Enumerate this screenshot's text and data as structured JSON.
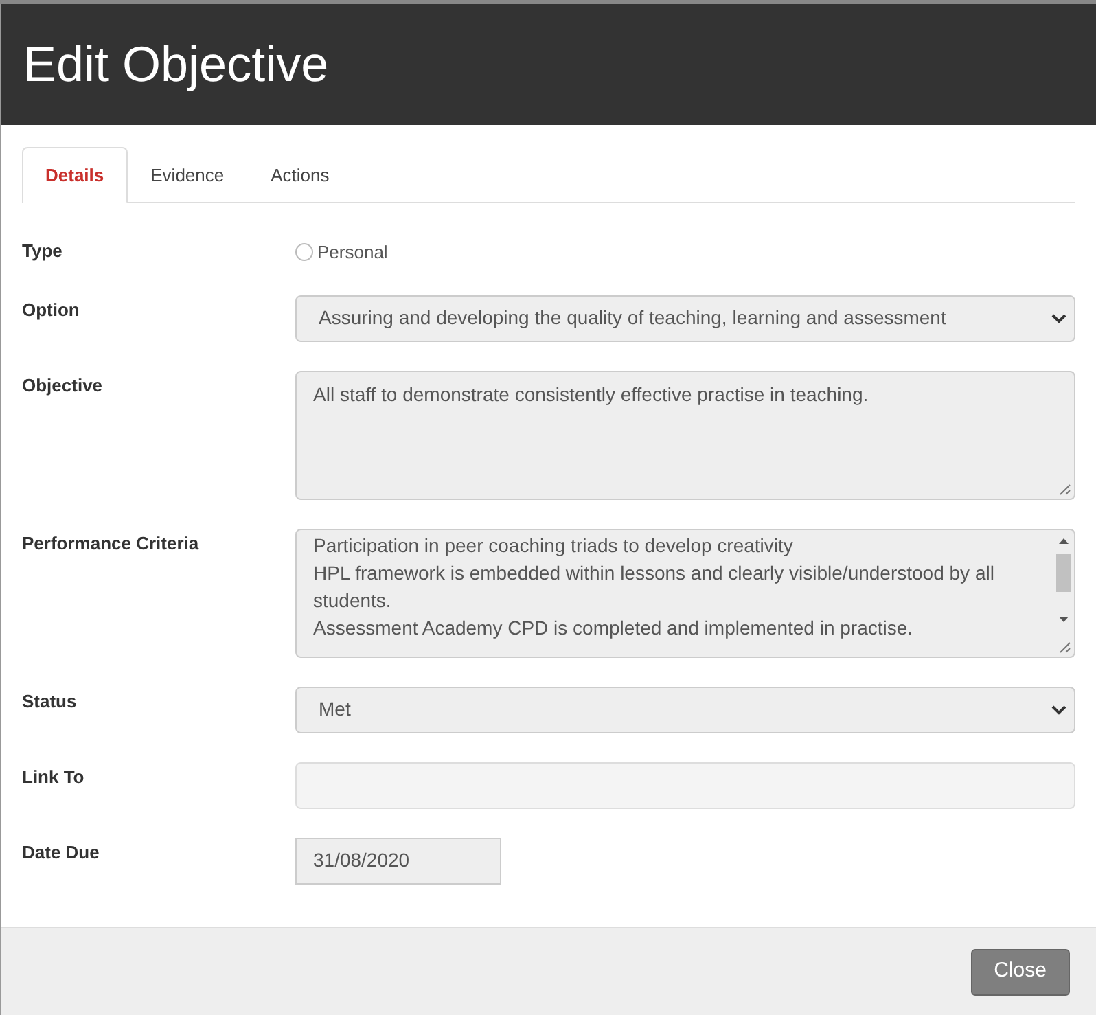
{
  "dialog": {
    "title": "Edit Objective"
  },
  "tabs": [
    {
      "label": "Details",
      "selected": true
    },
    {
      "label": "Evidence",
      "selected": false
    },
    {
      "label": "Actions",
      "selected": false
    }
  ],
  "fields": [
    {
      "kind": "radio",
      "label": "Type",
      "option": "Personal",
      "checked": false
    },
    {
      "kind": "select",
      "label": "Option",
      "value": "Assuring and developing the quality of teaching, learning and assessment"
    },
    {
      "kind": "textarea",
      "label": "Objective",
      "lines": [
        "All staff to demonstrate consistently effective practise in teaching."
      ]
    },
    {
      "kind": "scroll-textarea",
      "label": "Performance Criteria",
      "lines": [
        "Participation in peer coaching triads to develop creativity",
        "HPL framework is embedded within lessons and clearly visible/understood by all students.",
        "Assessment Academy CPD is completed and implemented in practise."
      ]
    },
    {
      "kind": "select",
      "label": "Status",
      "value": "Met"
    },
    {
      "kind": "input",
      "label": "Link To"
    },
    {
      "kind": "date",
      "label": "Date Due",
      "value": "31/08/2020"
    }
  ],
  "footer": {
    "buttons": [
      "Close"
    ]
  }
}
